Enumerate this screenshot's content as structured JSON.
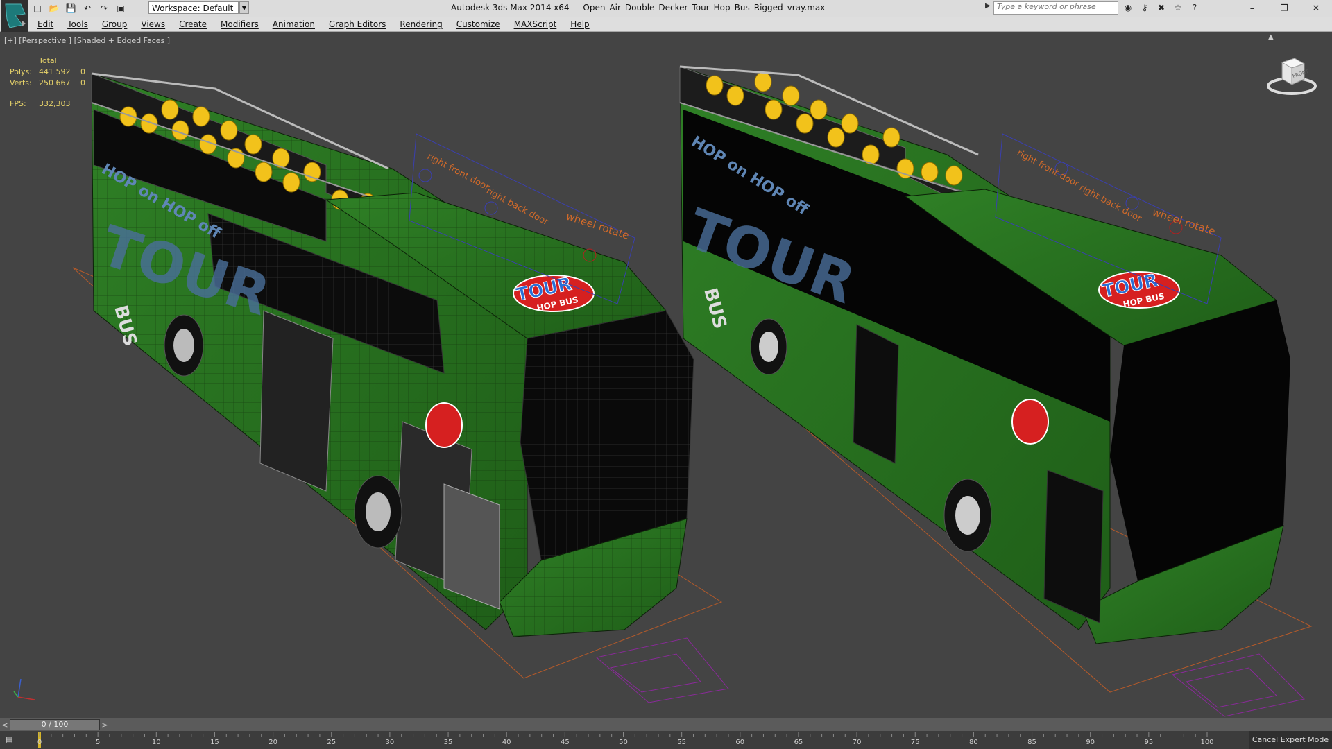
{
  "app": {
    "name": "Autodesk 3ds Max  2014 x64",
    "file": "Open_Air_Double_Decker_Tour_Hop_Bus_Rigged_vray.max"
  },
  "toolbar": {
    "workspace_label": "Workspace: Default"
  },
  "search": {
    "placeholder": "Type a keyword or phrase"
  },
  "menu": [
    "Edit",
    "Tools",
    "Group",
    "Views",
    "Create",
    "Modifiers",
    "Animation",
    "Graph Editors",
    "Rendering",
    "Customize",
    "MAXScript",
    "Help"
  ],
  "viewport": {
    "label": "[+] [Perspective ] [Shaded + Edged Faces ]",
    "stats": {
      "total_label": "Total",
      "polys_label": "Polys:",
      "polys_value": "441 592",
      "polys_selected": "0",
      "verts_label": "Verts:",
      "verts_value": "250 667",
      "verts_selected": "0",
      "fps_label": "FPS:",
      "fps_value": "332,303"
    },
    "viewcube_label": "FRONT",
    "bus_left": {
      "brand_side": "HOP on HOP off",
      "big_side": "TOUR",
      "bus_word": "BUS",
      "logo_top": "TOUR",
      "logo_sub": "HOP BUS",
      "helper_labels": [
        "right front door",
        "right back door",
        "wheel rotate"
      ]
    },
    "bus_right": {
      "brand_side": "HOP on HOP off",
      "big_side": "TOUR",
      "bus_word": "BUS",
      "logo_top": "TOUR",
      "logo_sub": "HOP BUS",
      "helper_labels": [
        "right front door",
        "right back door",
        "wheel rotate"
      ]
    },
    "colors": {
      "bus_green": "#2d7a22",
      "seat_yellow": "#f2c21b",
      "wire": "#152a10",
      "ground_line": "#b45a2a",
      "helper_plane": "#3a3fb0",
      "helper_text": "#d06a2a",
      "logo_red": "#d62020",
      "logo_blue": "#2a6fd6"
    }
  },
  "timeline": {
    "slider_label": "0 / 100",
    "prev": "<",
    "next": ">"
  },
  "trackbar": {
    "ticks": [
      0,
      5,
      10,
      15,
      20,
      25,
      30,
      35,
      40,
      45,
      50,
      55,
      60,
      65,
      70,
      75,
      80,
      85,
      90,
      95,
      100
    ]
  },
  "status": {
    "cancel_expert_mode": "Cancel Expert Mode"
  }
}
